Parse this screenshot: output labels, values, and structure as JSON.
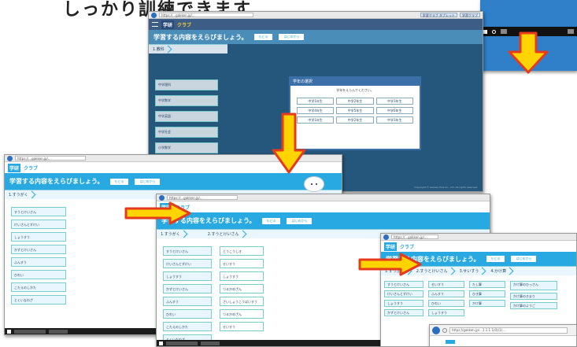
{
  "heading": "しっかり訓練できます",
  "colors": {
    "header": "#3c5e86",
    "accent_blue": "#29a9e1",
    "arrow_fill": "#ffd400",
    "arrow_stroke": "#e53a1c"
  },
  "shot1": {
    "url": "https://...gakken.jp/...",
    "tabs": [
      "学習クラブ タブレット",
      "学習クラブ"
    ],
    "logo": "学研",
    "brand": "クラブ",
    "prompt": "学習する内容をえらびましょう。",
    "pills": [
      "もどる",
      "はじめから"
    ],
    "crumb": "1.教科",
    "menu": [
      "中学理科",
      "中学数学",
      "中学英語",
      "中学社会",
      "小学数学"
    ],
    "dialog": {
      "title": "学年の選択",
      "desc": "学年をえらんでください。",
      "grades": [
        "中学1年生",
        "中学2年生",
        "中学3年生",
        "中学4年生",
        "中学5年生",
        "中学6年生",
        "中学1年生",
        "中学2年生",
        "中学3年生"
      ]
    },
    "footer": "Copyright © Gakken Plus Co., Ltd. All rights reserved."
  },
  "shot2": {
    "url": "https://...gakken.jp/...",
    "logo": "学研",
    "brand": "クラブ",
    "prompt": "学習する内容をえらびましょう。",
    "pills": [
      "もどる",
      "はじめから"
    ],
    "crumb": "1.すうがく",
    "menu": [
      "すうとけいさん",
      "けいさんとずけい",
      "しょうすう",
      "かずとけいさん",
      "ふんすう",
      "ひれい",
      "こたえのしかた",
      "とくいなわざ"
    ]
  },
  "shot3": {
    "url": "https://...gakken.jp/...",
    "logo": "学研",
    "brand": "クラブ",
    "prompt": "学習する内容をえらびましょう。",
    "pills": [
      "もどる",
      "はじめから"
    ],
    "crumbs": [
      "1.すうがく",
      "2.すうとけいさん"
    ],
    "col1": [
      "すうとけいさん",
      "けいさんとずけい",
      "しょうすう",
      "かずとけいさん",
      "ふんすう",
      "ひれい",
      "こたえのしかた",
      "とくいなわざ"
    ],
    "col2": [
      "とうこうしき",
      "せいすう",
      "しょうすう",
      "つるかめざん",
      "さいしょうこうばいすう",
      "つるかめざん",
      "せいすう"
    ]
  },
  "shot4": {
    "url": "https://...gakken.jp/...",
    "logo": "学研",
    "brand": "クラブ",
    "prompt": "学習する内容をえらびましょう。",
    "pills": [
      "もどる",
      "はじめから"
    ],
    "crumbs": [
      "1.すうがく",
      "2.すうとけいさん",
      "3.せいすう",
      "4.かけ算"
    ],
    "col1": [
      "すうとけいさん",
      "けいさんとずけい",
      "しょうすう",
      "かずとけいさん"
    ],
    "col2": [
      "せいすう",
      "ふんすう",
      "ひれい",
      "しょうすう"
    ],
    "col3": [
      "たし算",
      "ひき算",
      "かけ算"
    ],
    "col4": [
      "かけ算のひっさん",
      "かけ算のきまり",
      "かけ算のようご"
    ]
  },
  "shot5": {
    "url": "https://gakken.jp/...1.1.1.1(0)(1)..."
  }
}
